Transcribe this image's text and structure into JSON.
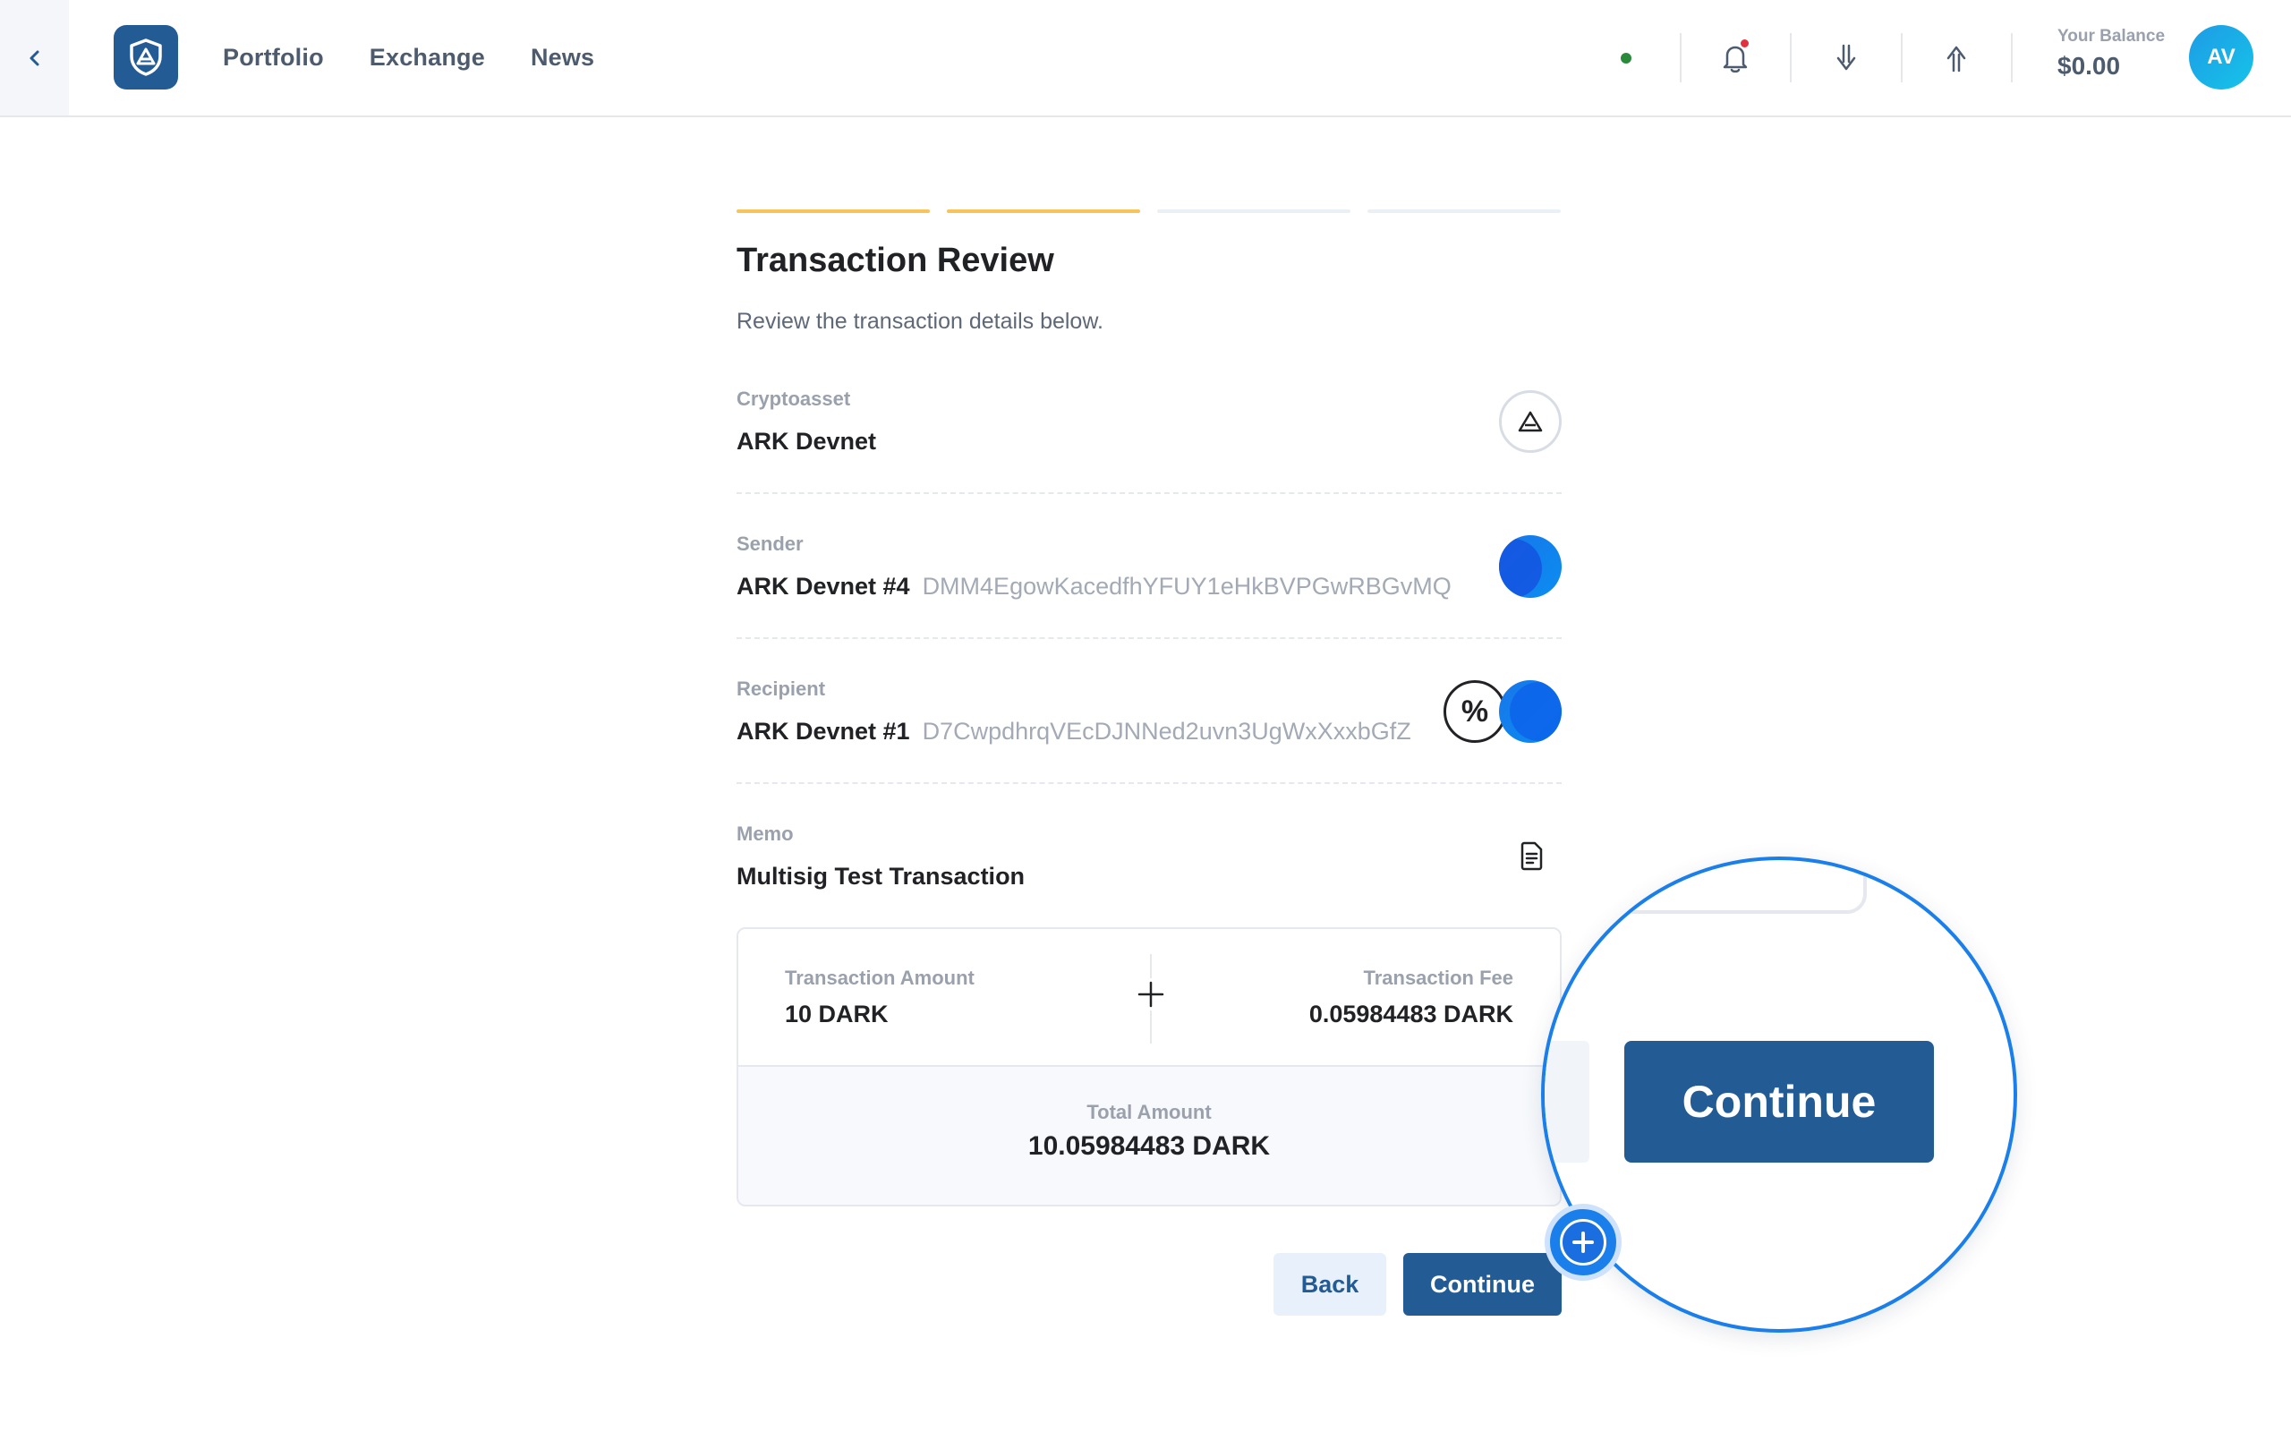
{
  "header": {
    "nav": [
      "Portfolio",
      "Exchange",
      "News"
    ],
    "balance_label": "Your Balance",
    "balance_value": "$0.00",
    "avatar_initials": "AV"
  },
  "stepper": {
    "total_steps": 4,
    "completed_steps": 2
  },
  "review": {
    "title": "Transaction Review",
    "subtitle": "Review the transaction details below.",
    "cryptoasset": {
      "label": "Cryptoasset",
      "value": "ARK Devnet"
    },
    "sender": {
      "label": "Sender",
      "name": "ARK Devnet #4",
      "address": "DMM4EgowKacedfhYFUY1eHkBVPGwRBGvMQ"
    },
    "recipient": {
      "label": "Recipient",
      "name": "ARK Devnet #1",
      "address": "D7CwpdhrqVEcDJNNed2uvn3UgWxXxxbGfZ"
    },
    "memo": {
      "label": "Memo",
      "value": "Multisig Test Transaction"
    }
  },
  "summary": {
    "amount_label": "Transaction Amount",
    "amount_value": "10 DARK",
    "fee_label": "Transaction Fee",
    "fee_value": "0.05984483 DARK",
    "total_label": "Total Amount",
    "total_value": "10.05984483 DARK"
  },
  "buttons": {
    "back": "Back",
    "continue": "Continue"
  },
  "colors": {
    "primary": "#235b95",
    "step_done": "#f6c45b",
    "step_pending": "#ebf0f7",
    "accent_blue": "#1a7fea",
    "status_online": "#2a8a3c",
    "notification": "#e0313e"
  }
}
